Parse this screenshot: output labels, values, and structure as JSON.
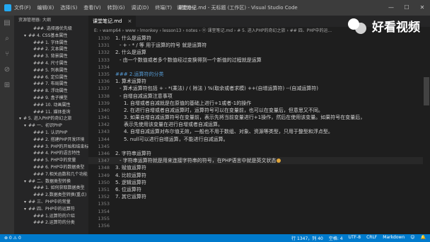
{
  "window": {
    "title": "课堂笔记.md - 无标题 (工作区) - Visual Studio Code",
    "menu": [
      "文件(F)",
      "编辑(E)",
      "选择(S)",
      "查看(V)",
      "转到(G)",
      "调试(D)",
      "终端(T)",
      "帮助(H)"
    ],
    "controls": [
      "—",
      "☐",
      "✕"
    ]
  },
  "watermark": {
    "text": "好看视频"
  },
  "sidebar": {
    "header": "资源管理器: 大纲",
    "outline": [
      {
        "indent": 3,
        "text": "###. 选择器优先级"
      },
      {
        "indent": 2,
        "text": "## 4. CSS基本属性"
      },
      {
        "indent": 3,
        "text": "### 1. 字体属性"
      },
      {
        "indent": 3,
        "text": "### 2. 文本属性"
      },
      {
        "indent": 3,
        "text": "### 3. 背景属性"
      },
      {
        "indent": 3,
        "text": "### 4. 尺寸属性"
      },
      {
        "indent": 3,
        "text": "### 5. 列表属性"
      },
      {
        "indent": 3,
        "text": "### 6. 定位属性"
      },
      {
        "indent": 3,
        "text": "### 7. 布局属性"
      },
      {
        "indent": 3,
        "text": "### 8. 浮动属性"
      },
      {
        "indent": 3,
        "text": "### 9. 盒子模型"
      },
      {
        "indent": 3,
        "text": "### 10. 动画属性"
      },
      {
        "indent": 3,
        "text": "### 11. 媒体查询"
      },
      {
        "indent": 1,
        "text": "# 5. 进入PHP的奇幻之旅"
      },
      {
        "indent": 2,
        "text": "## 一、初识PHP"
      },
      {
        "indent": 3,
        "text": "### 1. 认识PHP"
      },
      {
        "indent": 3,
        "text": "### 2. 搭建PHP开发环境"
      },
      {
        "indent": 3,
        "text": "### 3. PHP的开始和结束标记"
      },
      {
        "indent": 3,
        "text": "### 4. PHP的语言特性"
      },
      {
        "indent": 3,
        "text": "### 5. PHP中的变量"
      },
      {
        "indent": 3,
        "text": "### 6. PHP中的数据类型"
      },
      {
        "indent": 3,
        "text": "### 7.相关函数和几个功能"
      },
      {
        "indent": 2,
        "text": "## 二、数据类型转换"
      },
      {
        "indent": 3,
        "text": "### 1. 如何获取数据类型"
      },
      {
        "indent": 3,
        "text": "### 2.数据类型转换(重点)"
      },
      {
        "indent": 2,
        "text": "## 三、PHP中的常量"
      },
      {
        "indent": 2,
        "text": "## 四、PHP中的运算符"
      },
      {
        "indent": 3,
        "text": "### 1.运算符的介绍"
      },
      {
        "indent": 3,
        "text": "### 2.运算符的分类"
      }
    ]
  },
  "editor": {
    "tab": {
      "label": "课堂笔记.md",
      "close": "×"
    },
    "breadcrumb": "E: › wamp64 › www › lmonkey › lesson13 › notes › ⓜ 课堂笔记.md › # 5. 进入PHP的奇幻之旅 › ## 四、PHP中的运...",
    "lines": [
      {
        "n": "1330",
        "text": "1. 什么是运算符",
        "color": "#d4d4d4",
        "indent": 0
      },
      {
        "n": "1331",
        "text": "- + - * / 等 用于运算的符号 就是运算符",
        "color": "#d4d4d4",
        "indent": 1
      },
      {
        "n": "1332",
        "text": "2. 什么是运算",
        "color": "#d4d4d4",
        "indent": 0
      },
      {
        "n": "1333",
        "text": "- 由一个数值或者多个数值经过变换得到一个新值的过程就是运算",
        "color": "#d4d4d4",
        "indent": 1
      },
      {
        "n": "1334",
        "text": "",
        "color": "#d4d4d4",
        "indent": 0
      },
      {
        "n": "1335",
        "text": "### 2.运算符的分类",
        "color": "#569cd6",
        "indent": 0
      },
      {
        "n": "1336",
        "text": "1. 算术运算符",
        "color": "#d4d4d4",
        "indent": 0
      },
      {
        "n": "1337",
        "text": "- 算术运算符包括 + - *(乘法) / ( 除法 ) %(取余或者求模) ++(自增运算符) --(自减运算符)",
        "color": "#d4d4d4",
        "indent": 1
      },
      {
        "n": "1338",
        "text": "- 自增自减运算注意事项",
        "color": "#d4d4d4",
        "indent": 1
      },
      {
        "n": "1339",
        "text": "1. 自增或者自减就是在原值的基础上进行+1或者-1的操作",
        "color": "#d4d4d4",
        "indent": 2
      },
      {
        "n": "1340",
        "text": "2. 在进行自增或者自减运算时，运算符号可以在变量前，也可以在变量后，但意思又不同。",
        "color": "#d4d4d4",
        "indent": 2
      },
      {
        "n": "1341",
        "text": "3. 如果自增自减运算符号在变量前，表示先将当前变量进行+1操作，然后在使用该变量。如果符号在变量后，",
        "color": "#d4d4d4",
        "indent": 2
      },
      {
        "n": "1342",
        "text": "表示先使用该变量在进行自增或者自减运算。",
        "color": "#d4d4d4",
        "indent": 2
      },
      {
        "n": "1343",
        "text": "4. 自增自减运算对布尔值无效，一般也不用于数组、对象、资源等类型，只用于整型和浮点型。",
        "color": "#d4d4d4",
        "indent": 2
      },
      {
        "n": "1344",
        "text": "5. null可以进行自增运算，不能进行自减运算。",
        "color": "#d4d4d4",
        "indent": 2
      },
      {
        "n": "1345",
        "text": "",
        "color": "#d4d4d4",
        "indent": 0
      },
      {
        "n": "1346",
        "text": "2. 字符串运算符",
        "color": "#d4d4d4",
        "indent": 0
      },
      {
        "n": "1347",
        "text": "- 字符串运算符就是用来连接字符串的符号，在PHP语言中就是英文状态",
        "color": "#d4d4d4",
        "indent": 1,
        "cursor": true
      },
      {
        "n": "1348",
        "text": "3. 赋值运算符",
        "color": "#d4d4d4",
        "indent": 0
      },
      {
        "n": "1349",
        "text": "4. 比较运算符",
        "color": "#d4d4d4",
        "indent": 0
      },
      {
        "n": "1350",
        "text": "5. 逻辑运算符",
        "color": "#d4d4d4",
        "indent": 0
      },
      {
        "n": "1351",
        "text": "6. 位运算符",
        "color": "#d4d4d4",
        "indent": 0
      },
      {
        "n": "1352",
        "text": "7. 其它运算符",
        "color": "#d4d4d4",
        "indent": 0
      },
      {
        "n": "1353",
        "text": "",
        "color": "#d4d4d4",
        "indent": 0
      },
      {
        "n": "1354",
        "text": "",
        "color": "#d4d4d4",
        "indent": 0
      },
      {
        "n": "1355",
        "text": "",
        "color": "#d4d4d4",
        "indent": 0
      },
      {
        "n": "1356",
        "text": "",
        "color": "#d4d4d4",
        "indent": 0
      }
    ]
  },
  "statusbar": {
    "left": [
      "⊗ 0 ⚠ 0"
    ],
    "right": [
      "行 1347，列 40",
      "空格: 4",
      "UTF-8",
      "CRLF",
      "Markdown",
      "☺",
      "🔔"
    ]
  },
  "colors": {
    "accent": "#007acc",
    "heading": "#569cd6",
    "cursor": "#e0a53a"
  }
}
